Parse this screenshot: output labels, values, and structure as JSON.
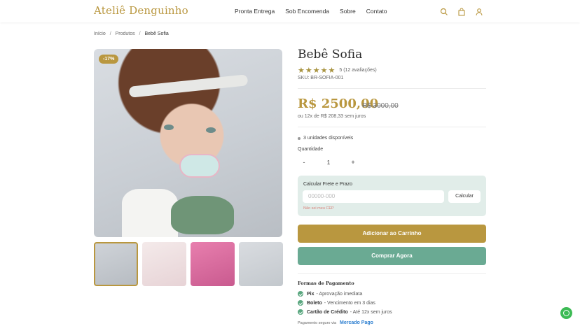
{
  "header": {
    "logo": "Ateliê Denguinho",
    "nav": [
      "Pronta Entrega",
      "Sob Encomenda",
      "Sobre",
      "Contato"
    ]
  },
  "breadcrumb": {
    "items": [
      "Início",
      "Produtos",
      "Bebê Sofia"
    ],
    "separator": "/"
  },
  "product": {
    "discount_badge": "-17%",
    "title": "Bebê Sofia",
    "rating_value": 5,
    "rating_text": "5 (12 avaliações)",
    "sku": "SKU: BR-SOFIA-001",
    "price": "R$ 2500,00",
    "old_price": "R$ 3000,00",
    "installments": "ou 12x de R$ 208,33 sem juros",
    "stock": "3 unidades disponíveis",
    "quantity_label": "Quantidade",
    "quantity_value": "1",
    "minus": "-",
    "plus": "+"
  },
  "shipping": {
    "title": "Calcular Frete e Prazo",
    "placeholder": "00000-000",
    "button": "Calcular",
    "link": "Não sei meu CEP"
  },
  "actions": {
    "add_to_cart": "Adicionar ao Carrinho",
    "buy_now": "Comprar Agora"
  },
  "payment": {
    "title": "Formas de Pagamento",
    "methods": [
      {
        "name": "Pix",
        "detail": "- Aprovação imediata"
      },
      {
        "name": "Boleto",
        "detail": "- Vencimento em 3 dias"
      },
      {
        "name": "Cartão de Crédito",
        "detail": "- Até 12x sem juros"
      }
    ],
    "secure_text": "Pagamento seguro via",
    "provider": "Mercado Pago"
  },
  "colors": {
    "brand_gold": "#b9973f",
    "green": "#6aaa93",
    "light_green": "#e1ede9"
  }
}
